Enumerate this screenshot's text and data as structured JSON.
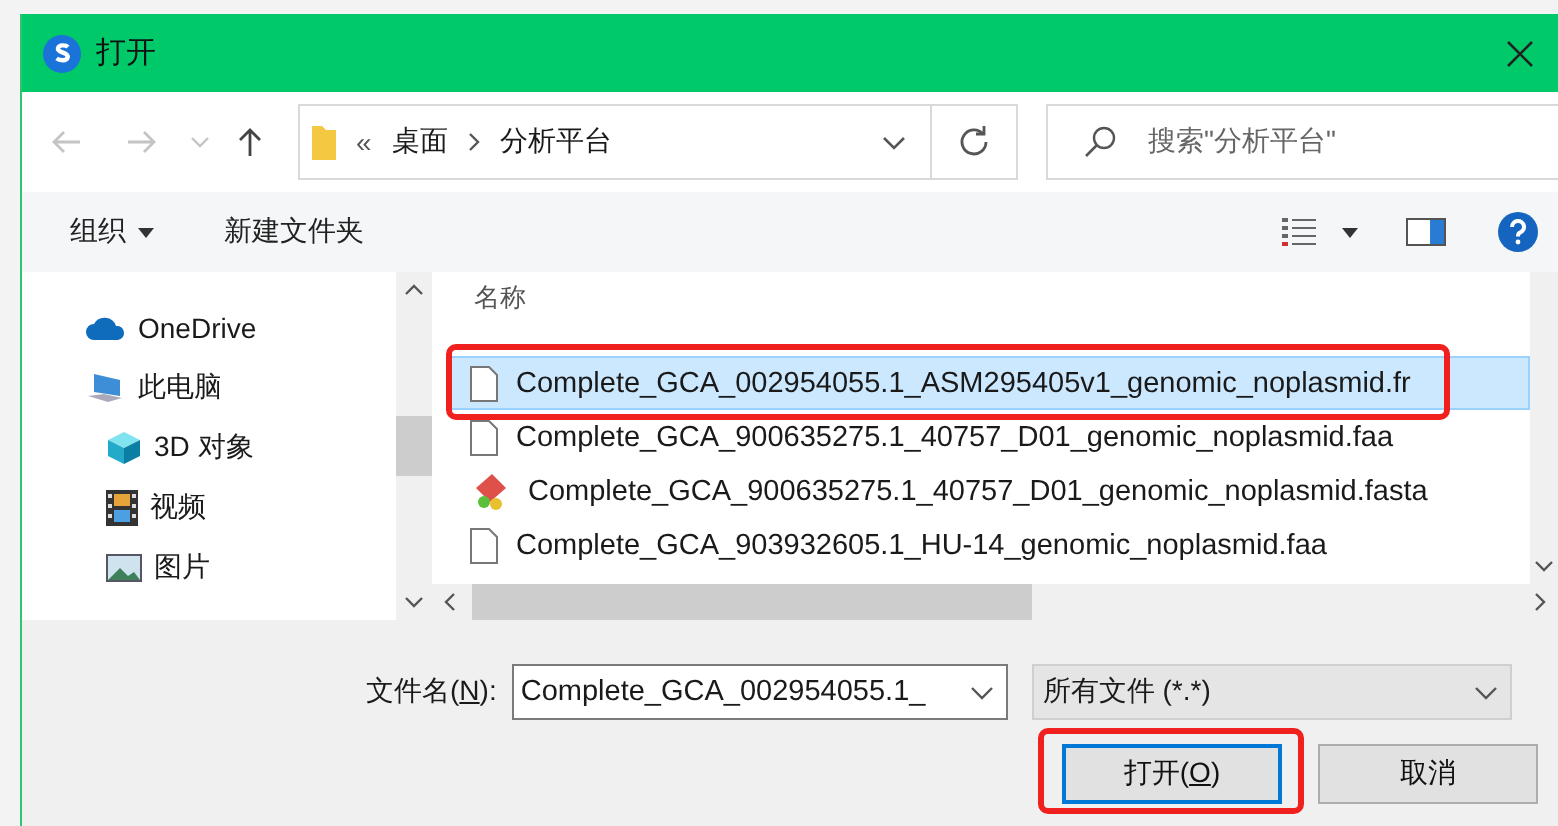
{
  "window": {
    "title": "打开"
  },
  "nav": {
    "overflow": "«",
    "path": [
      {
        "label": "桌面"
      },
      {
        "label": "分析平台"
      }
    ],
    "search": {
      "placeholder": "搜索\"分析平台\""
    }
  },
  "toolbar": {
    "organize": "组织",
    "new_folder": "新建文件夹"
  },
  "sidebar": {
    "items": [
      {
        "label": "OneDrive",
        "kind": "cloud"
      },
      {
        "label": "此电脑",
        "kind": "computer",
        "children": [
          {
            "label": "3D 对象",
            "kind": "cube"
          },
          {
            "label": "视频",
            "kind": "film"
          },
          {
            "label": "图片",
            "kind": "image"
          }
        ]
      }
    ]
  },
  "file_list": {
    "columns": [
      "名称"
    ],
    "rows": [
      {
        "name": "Complete_GCA_002954055.1_ASM295405v1_genomic_noplasmid.fr",
        "kind": "document",
        "selected": true
      },
      {
        "name": "Complete_GCA_900635275.1_40757_D01_genomic_noplasmid.faa",
        "kind": "document",
        "selected": false
      },
      {
        "name": "Complete_GCA_900635275.1_40757_D01_genomic_noplasmid.fasta",
        "kind": "app",
        "selected": false
      },
      {
        "name": "Complete_GCA_903932605.1_HU-14_genomic_noplasmid.faa",
        "kind": "document",
        "selected": false
      }
    ]
  },
  "footer": {
    "filename": {
      "label": "文件名(",
      "mnemonic": "N",
      "suffix": "):",
      "value": "Complete_GCA_002954055.1_"
    },
    "filter": "所有文件 (*.*)",
    "buttons": [
      {
        "label": "打开(",
        "mnemonic": "O",
        "suffix": ")",
        "kind": "primary"
      },
      {
        "label": "取消",
        "kind": "cancel"
      }
    ]
  }
}
